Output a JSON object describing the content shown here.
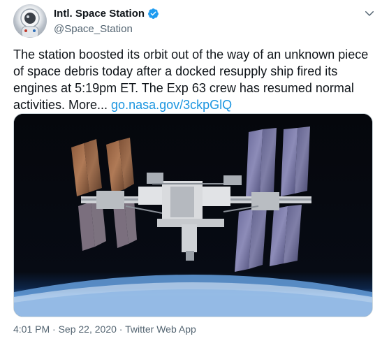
{
  "account": {
    "display_name": "Intl. Space Station",
    "handle": "@Space_Station",
    "verified": true
  },
  "tweet": {
    "text_before_link": "The station boosted its orbit out of the way of an unknown piece of space debris today after a docked resupply ship fired its engines at 5:19pm ET. The Exp 63 crew has resumed normal activities. More... ",
    "link_text": "go.nasa.gov/3ckpGlQ"
  },
  "meta": {
    "time": "4:01 PM",
    "date": "Sep 22, 2020",
    "app": "Twitter Web App",
    "separator": " · "
  },
  "icons": {
    "verified": "verified-badge-icon",
    "more": "chevron-down-icon"
  },
  "colors": {
    "link": "#1b95e0",
    "verified": "#1d9bf0",
    "secondary_text": "#536471"
  }
}
